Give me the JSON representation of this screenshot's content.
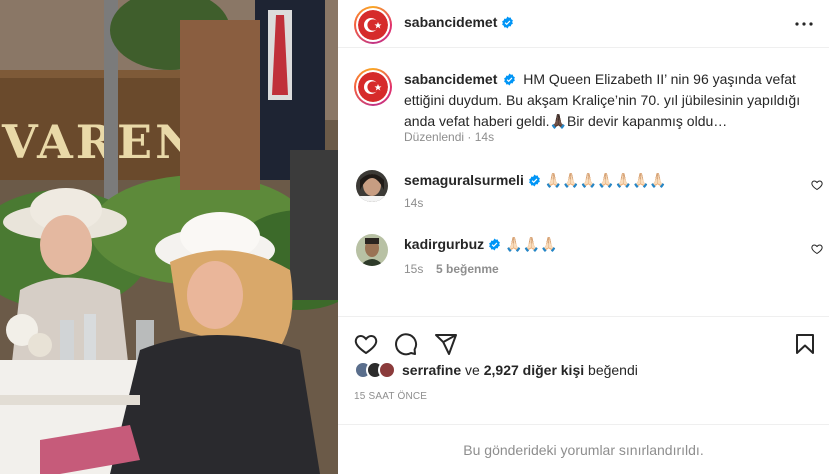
{
  "post": {
    "author": "sabancidemet",
    "verified": true
  },
  "caption": {
    "username": "sabancidemet",
    "text": "HM Queen Elizabeth II’ nin 96 yaşında vefat ettiğini duydum. Bu akşam Kraliçe’nin 70. yıl jübilesinin yapıldığı anda vefat haberi geldi.🙏🏿Bir devir kapanmış oldu…",
    "edited_label": "Düzenlendi",
    "separator": "·",
    "time": "14s"
  },
  "comments": [
    {
      "username": "semaguralsurmeli",
      "verified": true,
      "text": "🙏🏻🙏🏻🙏🏻🙏🏻🙏🏻🙏🏻🙏🏻",
      "time": "14s",
      "likes": ""
    },
    {
      "username": "kadirgurbuz",
      "verified": true,
      "text": "🙏🏻🙏🏻🙏🏻",
      "time": "15s",
      "likes": "5 beğenme"
    }
  ],
  "likes": {
    "first_user": "serrafine",
    "connector": "ve",
    "others": "2,927 diğer kişi",
    "suffix": "beğendi"
  },
  "time_ago": "15 SAAT ÖNCE",
  "footer_text": "Bu gönderideki yorumlar sınırlandırıldı.",
  "icons": [
    "more-icon",
    "heart-icon",
    "comment-icon",
    "share-icon",
    "bookmark-icon",
    "verified-icon"
  ],
  "colors": {
    "verified": "#0095f6",
    "muted": "#8e8e8e",
    "text": "#262626",
    "border": "#efefef"
  }
}
